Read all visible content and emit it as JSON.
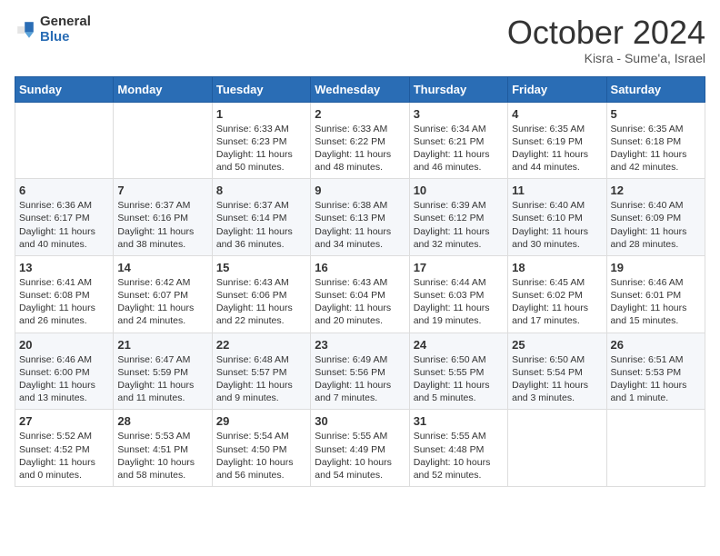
{
  "logo": {
    "general": "General",
    "blue": "Blue",
    "icon_color": "#2a6db5"
  },
  "header": {
    "month_title": "October 2024",
    "location": "Kisra - Sume'a, Israel"
  },
  "weekdays": [
    "Sunday",
    "Monday",
    "Tuesday",
    "Wednesday",
    "Thursday",
    "Friday",
    "Saturday"
  ],
  "weeks": [
    [
      {
        "day": "",
        "content": ""
      },
      {
        "day": "",
        "content": ""
      },
      {
        "day": "1",
        "content": "Sunrise: 6:33 AM\nSunset: 6:23 PM\nDaylight: 11 hours and 50 minutes."
      },
      {
        "day": "2",
        "content": "Sunrise: 6:33 AM\nSunset: 6:22 PM\nDaylight: 11 hours and 48 minutes."
      },
      {
        "day": "3",
        "content": "Sunrise: 6:34 AM\nSunset: 6:21 PM\nDaylight: 11 hours and 46 minutes."
      },
      {
        "day": "4",
        "content": "Sunrise: 6:35 AM\nSunset: 6:19 PM\nDaylight: 11 hours and 44 minutes."
      },
      {
        "day": "5",
        "content": "Sunrise: 6:35 AM\nSunset: 6:18 PM\nDaylight: 11 hours and 42 minutes."
      }
    ],
    [
      {
        "day": "6",
        "content": "Sunrise: 6:36 AM\nSunset: 6:17 PM\nDaylight: 11 hours and 40 minutes."
      },
      {
        "day": "7",
        "content": "Sunrise: 6:37 AM\nSunset: 6:16 PM\nDaylight: 11 hours and 38 minutes."
      },
      {
        "day": "8",
        "content": "Sunrise: 6:37 AM\nSunset: 6:14 PM\nDaylight: 11 hours and 36 minutes."
      },
      {
        "day": "9",
        "content": "Sunrise: 6:38 AM\nSunset: 6:13 PM\nDaylight: 11 hours and 34 minutes."
      },
      {
        "day": "10",
        "content": "Sunrise: 6:39 AM\nSunset: 6:12 PM\nDaylight: 11 hours and 32 minutes."
      },
      {
        "day": "11",
        "content": "Sunrise: 6:40 AM\nSunset: 6:10 PM\nDaylight: 11 hours and 30 minutes."
      },
      {
        "day": "12",
        "content": "Sunrise: 6:40 AM\nSunset: 6:09 PM\nDaylight: 11 hours and 28 minutes."
      }
    ],
    [
      {
        "day": "13",
        "content": "Sunrise: 6:41 AM\nSunset: 6:08 PM\nDaylight: 11 hours and 26 minutes."
      },
      {
        "day": "14",
        "content": "Sunrise: 6:42 AM\nSunset: 6:07 PM\nDaylight: 11 hours and 24 minutes."
      },
      {
        "day": "15",
        "content": "Sunrise: 6:43 AM\nSunset: 6:06 PM\nDaylight: 11 hours and 22 minutes."
      },
      {
        "day": "16",
        "content": "Sunrise: 6:43 AM\nSunset: 6:04 PM\nDaylight: 11 hours and 20 minutes."
      },
      {
        "day": "17",
        "content": "Sunrise: 6:44 AM\nSunset: 6:03 PM\nDaylight: 11 hours and 19 minutes."
      },
      {
        "day": "18",
        "content": "Sunrise: 6:45 AM\nSunset: 6:02 PM\nDaylight: 11 hours and 17 minutes."
      },
      {
        "day": "19",
        "content": "Sunrise: 6:46 AM\nSunset: 6:01 PM\nDaylight: 11 hours and 15 minutes."
      }
    ],
    [
      {
        "day": "20",
        "content": "Sunrise: 6:46 AM\nSunset: 6:00 PM\nDaylight: 11 hours and 13 minutes."
      },
      {
        "day": "21",
        "content": "Sunrise: 6:47 AM\nSunset: 5:59 PM\nDaylight: 11 hours and 11 minutes."
      },
      {
        "day": "22",
        "content": "Sunrise: 6:48 AM\nSunset: 5:57 PM\nDaylight: 11 hours and 9 minutes."
      },
      {
        "day": "23",
        "content": "Sunrise: 6:49 AM\nSunset: 5:56 PM\nDaylight: 11 hours and 7 minutes."
      },
      {
        "day": "24",
        "content": "Sunrise: 6:50 AM\nSunset: 5:55 PM\nDaylight: 11 hours and 5 minutes."
      },
      {
        "day": "25",
        "content": "Sunrise: 6:50 AM\nSunset: 5:54 PM\nDaylight: 11 hours and 3 minutes."
      },
      {
        "day": "26",
        "content": "Sunrise: 6:51 AM\nSunset: 5:53 PM\nDaylight: 11 hours and 1 minute."
      }
    ],
    [
      {
        "day": "27",
        "content": "Sunrise: 5:52 AM\nSunset: 4:52 PM\nDaylight: 11 hours and 0 minutes."
      },
      {
        "day": "28",
        "content": "Sunrise: 5:53 AM\nSunset: 4:51 PM\nDaylight: 10 hours and 58 minutes."
      },
      {
        "day": "29",
        "content": "Sunrise: 5:54 AM\nSunset: 4:50 PM\nDaylight: 10 hours and 56 minutes."
      },
      {
        "day": "30",
        "content": "Sunrise: 5:55 AM\nSunset: 4:49 PM\nDaylight: 10 hours and 54 minutes."
      },
      {
        "day": "31",
        "content": "Sunrise: 5:55 AM\nSunset: 4:48 PM\nDaylight: 10 hours and 52 minutes."
      },
      {
        "day": "",
        "content": ""
      },
      {
        "day": "",
        "content": ""
      }
    ]
  ]
}
